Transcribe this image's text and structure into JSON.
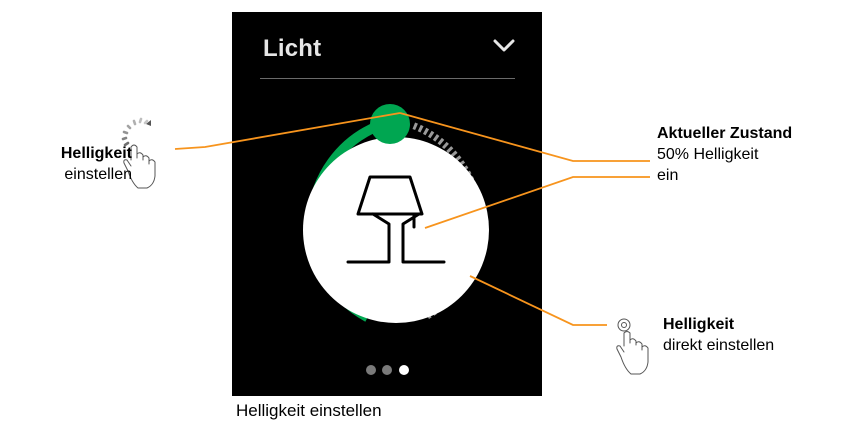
{
  "panel": {
    "title": "Licht",
    "brightness_percent": 50,
    "page_dots": {
      "count": 3,
      "active_index": 2
    }
  },
  "callouts": {
    "left": {
      "title": "Helligkeit",
      "text": "einstellen"
    },
    "top_right": {
      "title": "Aktueller Zustand",
      "line1": "50% Helligkeit",
      "line2": "ein"
    },
    "bottom_right": {
      "title": "Helligkeit",
      "text": "direkt einstellen"
    }
  },
  "caption": "Helligkeit einstellen",
  "icons": [
    "chevron-down-icon",
    "lamp-icon",
    "rotate-gesture-icon",
    "tap-gesture-icon"
  ],
  "colors": {
    "panel_bg": "#000000",
    "accent": "#00a651",
    "callout_line": "#f7941d",
    "arc_inactive": "#9a9a9a"
  }
}
